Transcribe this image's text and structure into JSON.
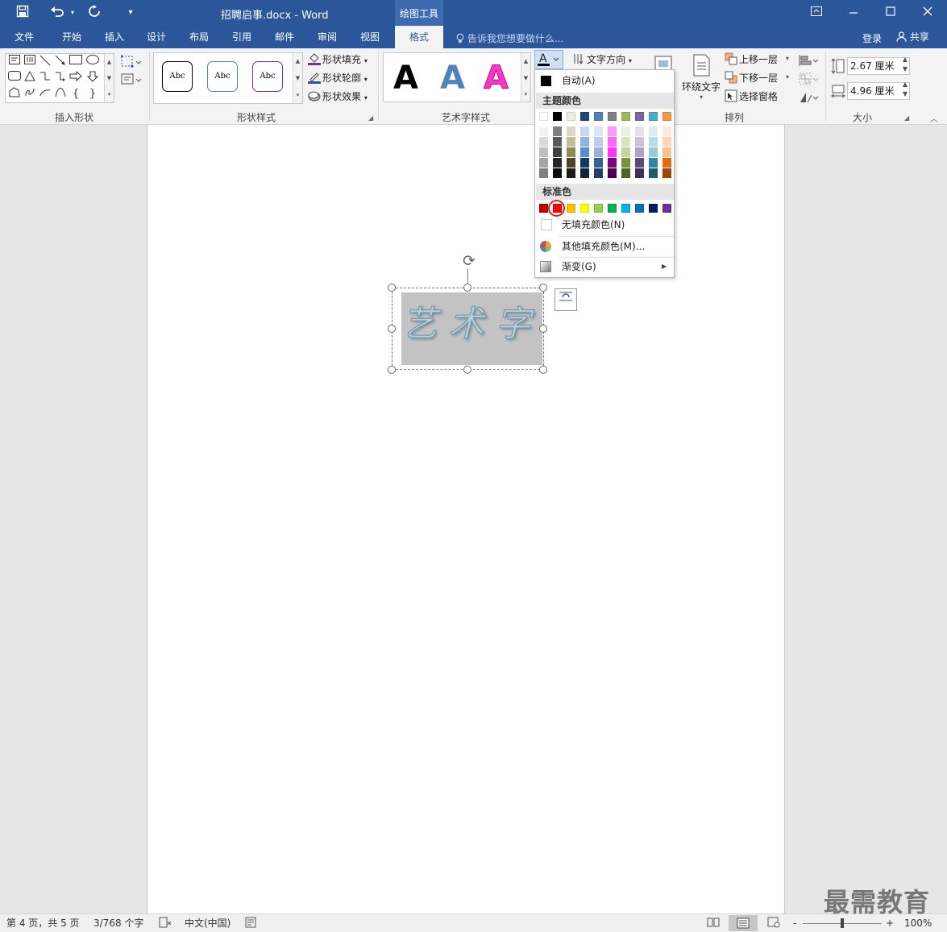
{
  "window": {
    "title": "招聘启事.docx - Word",
    "context_tab": "绘图工具"
  },
  "quick_access": {
    "save_icon": "save-icon",
    "undo_icon": "undo-icon",
    "redo_icon": "redo-icon",
    "customize_icon": "customize-qat-icon"
  },
  "tabs": [
    "文件",
    "开始",
    "插入",
    "设计",
    "布局",
    "引用",
    "邮件",
    "审阅",
    "视图",
    "格式"
  ],
  "active_tab": "格式",
  "tellme": "告诉我您想要做什么...",
  "account": {
    "login": "登录",
    "share": "共享"
  },
  "ribbon": {
    "groups": {
      "insert_shapes": "插入形状",
      "shape_styles": "形状样式",
      "wordart_styles": "艺术字样式",
      "arrange": "排列",
      "size": "大小"
    },
    "shape_style_samples": [
      "Abc",
      "Abc",
      "Abc"
    ],
    "shape_fill": "形状填充",
    "shape_outline": "形状轮廓",
    "shape_effects": "形状效果",
    "wordart_samples": [
      "A",
      "A",
      "A"
    ],
    "text_direction": "文字方向",
    "wrap_text": "环绕文字",
    "bring_forward": "上移一层",
    "send_backward": "下移一层",
    "selection_pane": "选择窗格",
    "height": "2.67 厘米",
    "width": "4.96 厘米"
  },
  "color_menu": {
    "auto": "自动(A)",
    "theme_colors_header": "主题颜色",
    "standard_colors_header": "标准色",
    "no_fill": "无填充颜色(N)",
    "more_colors": "其他填充颜色(M)...",
    "gradient": "渐变(G)",
    "theme_top": [
      "#ffffff",
      "#000000",
      "#eeece1",
      "#1f497d",
      "#4f81bd",
      "#7f7f7f",
      "#9bbb59",
      "#8064a2",
      "#4bacc6",
      "#f79646"
    ],
    "theme_shades": [
      [
        "#f2f2f2",
        "#d9d9d9",
        "#bfbfbf",
        "#a6a6a6",
        "#808080"
      ],
      [
        "#7f7f7f",
        "#595959",
        "#404040",
        "#262626",
        "#0d0d0d"
      ],
      [
        "#ddd9c4",
        "#c4bd97",
        "#948a54",
        "#4a452a",
        "#1e1c11"
      ],
      [
        "#c6d9f1",
        "#8db4e3",
        "#548dd4",
        "#17375e",
        "#10243f"
      ],
      [
        "#dce6f2",
        "#b9cde5",
        "#95b3d7",
        "#366092",
        "#244062"
      ],
      [
        "#ff99ff",
        "#ff66ff",
        "#ff33ff",
        "#800080",
        "#4d004d"
      ],
      [
        "#ebf1de",
        "#d7e4bd",
        "#c3d69b",
        "#77933c",
        "#4f6228"
      ],
      [
        "#e6e0ec",
        "#ccc1da",
        "#b3a2c7",
        "#604a7b",
        "#403152"
      ],
      [
        "#dbeef4",
        "#b7dee8",
        "#93cddd",
        "#31859c",
        "#215968"
      ],
      [
        "#fdeada",
        "#fcd5b5",
        "#fac090",
        "#e46c0a",
        "#984807"
      ]
    ],
    "standard": [
      "#c00000",
      "#ff0000",
      "#ffc000",
      "#ffff00",
      "#92d050",
      "#00b050",
      "#00b0f0",
      "#0070c0",
      "#002060",
      "#7030a0"
    ],
    "selected_standard": "#ff0000"
  },
  "document": {
    "wordart_text": "艺术字"
  },
  "status": {
    "page": "第 4 页，共 5 页",
    "words": "3/768 个字",
    "language": "中文(中国)",
    "zoom": "100%",
    "zoom_minus": "-",
    "zoom_plus": "+"
  },
  "watermark": "最需教育"
}
